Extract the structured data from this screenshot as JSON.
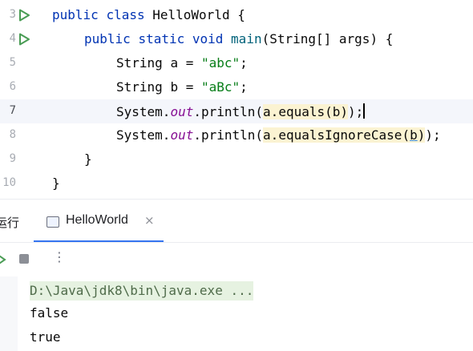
{
  "editor": {
    "lines": [
      {
        "num": "3",
        "has_run": true
      },
      {
        "num": "4",
        "has_run": true
      },
      {
        "num": "5",
        "has_run": false
      },
      {
        "num": "6",
        "has_run": false
      },
      {
        "num": "7",
        "has_run": false
      },
      {
        "num": "8",
        "has_run": false
      },
      {
        "num": "9",
        "has_run": false
      },
      {
        "num": "10",
        "has_run": false
      }
    ],
    "code": {
      "l3": {
        "kw1": "public",
        "kw2": "class",
        "name": "HelloWorld",
        "brace": "{"
      },
      "l4": {
        "kw1": "public",
        "kw2": "static",
        "kw3": "void",
        "fn": "main",
        "rest": "(String[] args) {"
      },
      "l5": {
        "type": "String",
        "decl": "a = ",
        "str": "\"abc\"",
        "end": ";"
      },
      "l6": {
        "type": "String",
        "decl": "b = ",
        "str": "\"aBc\"",
        "end": ";"
      },
      "l7": {
        "pre": "System.",
        "field": "out",
        "mid": ".println(",
        "hl": "a.equals(b)",
        "post": ");"
      },
      "l8": {
        "pre": "System.",
        "field": "out",
        "mid": ".println(",
        "hl_a": "a.equalsIgnoreCase(",
        "param": "b",
        "hl_b": ")",
        "post": ");"
      },
      "l9": {
        "brace": "}"
      },
      "l10": {
        "brace": "}"
      }
    }
  },
  "run_panel": {
    "title": "运行",
    "tab_label": "HelloWorld",
    "close_glyph": "×",
    "more_glyph": "⋮"
  },
  "console": {
    "command": "D:\\Java\\jdk8\\bin\\java.exe ...",
    "output": [
      "false",
      "true"
    ]
  },
  "colors": {
    "keyword": "#0033b3",
    "string": "#067d17",
    "field": "#871094",
    "run_green": "#499c54",
    "tab_underline": "#3574f0"
  }
}
